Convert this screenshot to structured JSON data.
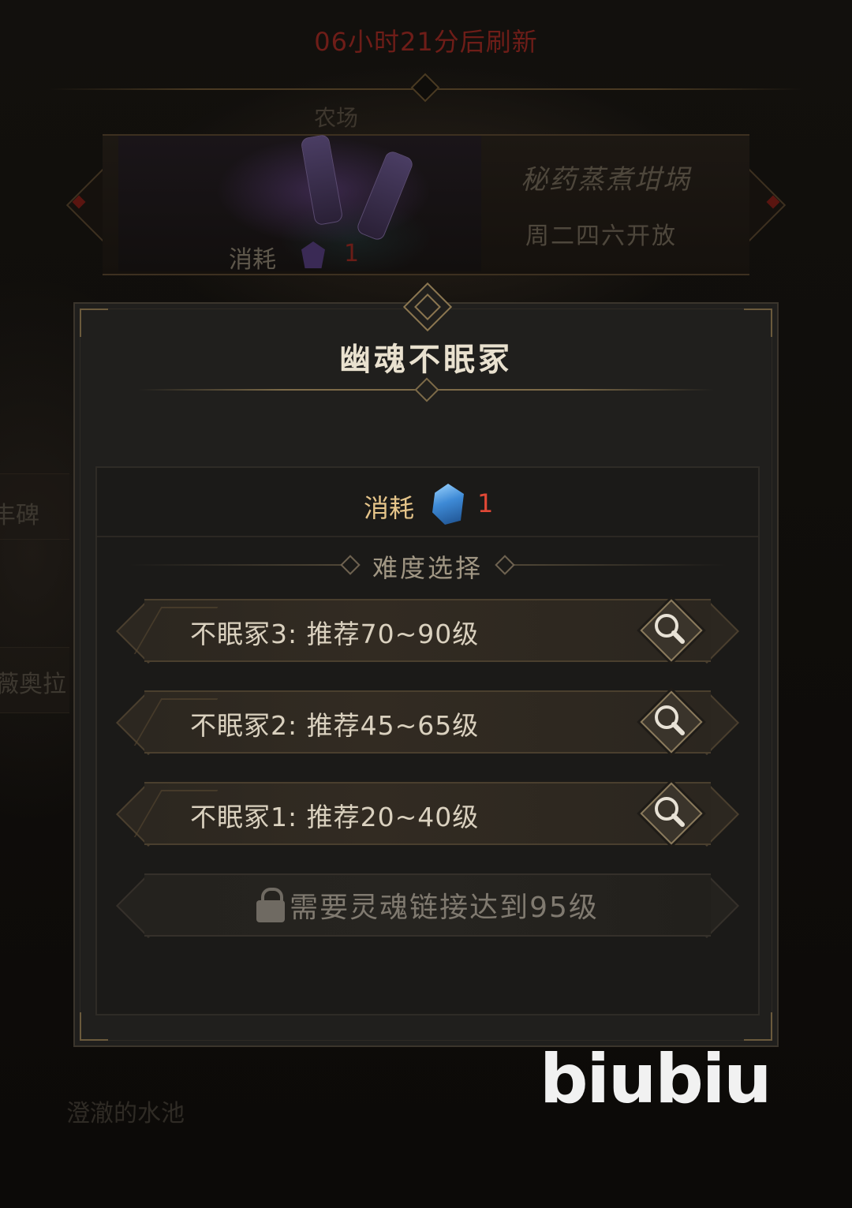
{
  "background": {
    "refresh_timer": "06小时21分后刷新",
    "location_label": "农场",
    "banner": {
      "title": "秘药蒸煮坩埚",
      "schedule": "周二四六开放",
      "cost_label": "消耗",
      "cost_value": "1"
    },
    "side_items": [
      "丰碑",
      "薇奥拉"
    ],
    "bottom_item": "澄澈的水池"
  },
  "modal": {
    "title": "幽魂不眠冢",
    "cost_label": "消耗",
    "cost_value": "1",
    "difficulty_label": "难度选择",
    "options": [
      {
        "label": "不眠冢3: 推荐70~90级"
      },
      {
        "label": "不眠冢2: 推荐45~65级"
      },
      {
        "label": "不眠冢1: 推荐20~40级"
      }
    ],
    "locked_option": {
      "label": "需要灵魂链接达到95级"
    }
  },
  "watermark": "biubiu",
  "colors": {
    "accent_gold": "#e6c58a",
    "cost_red": "#e14836",
    "timer_red": "#6e1d18",
    "panel_bg": "#201f1d"
  },
  "icons": {
    "cost_gem": "blue-crystal-icon",
    "option_button": "magnifier-icon",
    "locked": "lock-icon"
  }
}
